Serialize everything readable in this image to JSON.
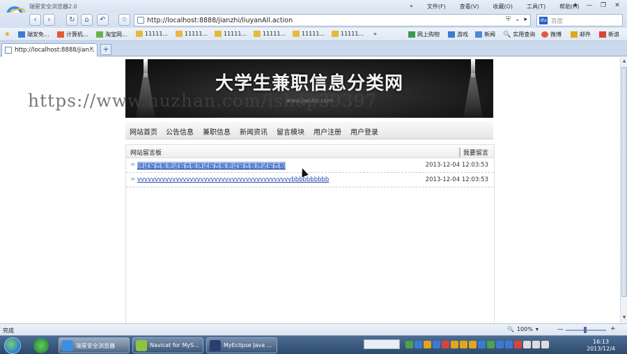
{
  "browser": {
    "window_title": "瑞星安全浏览器2.0",
    "menus": [
      "»",
      "文件(F)",
      "查看(V)",
      "收藏(O)",
      "工具(T)",
      "帮助(H)"
    ],
    "window_buttons": [
      "★",
      "—",
      "❐",
      "✕"
    ],
    "address": "http://localhost:8888/jianzhi/liuyanAll.action",
    "search_placeholder": "百度",
    "favorites": [
      "瑞安免...",
      "计算机...",
      "淘宝网...",
      "11111...",
      "11111...",
      "11111...",
      "11111...",
      "11111...",
      "网上购物",
      "游戏",
      "新闻",
      "实用查询",
      "微博",
      "邮件",
      "新浪"
    ],
    "favorites_more": "»",
    "tab_label": "http://localhost:8888/jian...",
    "tab_close": "✕",
    "new_tab": "+",
    "nav_buttons": [
      "‹",
      "›",
      "↻",
      "⌂",
      "↶",
      "☆"
    ]
  },
  "site": {
    "banner_title": "大学生兼职信息分类网",
    "banner_sub": "www.jianzhi.com",
    "watermark": "https://www.huzhan.com/ishop39397",
    "nav": [
      "网站首页",
      "公告信息",
      "兼职信息",
      "新闻资讯",
      "留言模块",
      "用户注册",
      "用户登录"
    ],
    "board_title": "网站留言板",
    "board_action": "我要留言",
    "messages": [
      {
        "text": "测试留言板测试留言板测试留言板测试留言板测试留言板",
        "date": "2013-12-04 12:03:53",
        "selected": true
      },
      {
        "text": "vvvvvvvvvvvvvvvvvvvvvvvvvvvvvvvvvvvvvvvvvvvvbbbbbbbbbb",
        "date": "2013-12-04 12:03:53",
        "selected": false
      }
    ]
  },
  "status": {
    "text": "完成",
    "zoom": "100%",
    "zoom_minus": "—",
    "zoom_plus": "+"
  },
  "taskbar": {
    "tasks": [
      "瑞星安全浏览器",
      "Navicat for MyS...",
      "MyEclipse Java ..."
    ],
    "clock_time": "16:13",
    "clock_date": "2013/12/4"
  }
}
